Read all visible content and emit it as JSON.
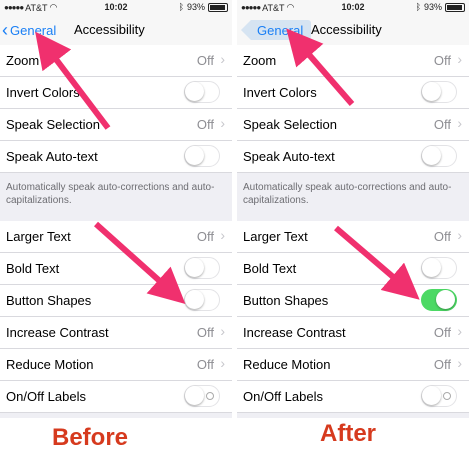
{
  "status": {
    "carrier": "AT&T",
    "time": "10:02",
    "battery": "93%"
  },
  "nav": {
    "back_label": "General",
    "title": "Accessibility"
  },
  "rows": {
    "zoom": {
      "label": "Zoom",
      "value": "Off"
    },
    "invert": {
      "label": "Invert Colors"
    },
    "speak_selection": {
      "label": "Speak Selection",
      "value": "Off"
    },
    "speak_autotext": {
      "label": "Speak Auto-text"
    },
    "larger_text": {
      "label": "Larger Text",
      "value": "Off"
    },
    "bold_text": {
      "label": "Bold Text"
    },
    "button_shapes": {
      "label": "Button Shapes"
    },
    "increase_contrast": {
      "label": "Increase Contrast",
      "value": "Off"
    },
    "reduce_motion": {
      "label": "Reduce Motion",
      "value": "Off"
    },
    "onoff_labels": {
      "label": "On/Off Labels"
    }
  },
  "footnote": "Automatically speak auto-corrections and auto-capitalizations.",
  "captions": {
    "before": "Before",
    "after": "After"
  },
  "states": {
    "before_button_shapes": "off",
    "after_button_shapes": "on"
  },
  "colors": {
    "ios_blue": "#1a7ff5",
    "toggle_green": "#4cd964",
    "arrow_pink": "#f0306e",
    "caption_red": "#d63a1e"
  }
}
